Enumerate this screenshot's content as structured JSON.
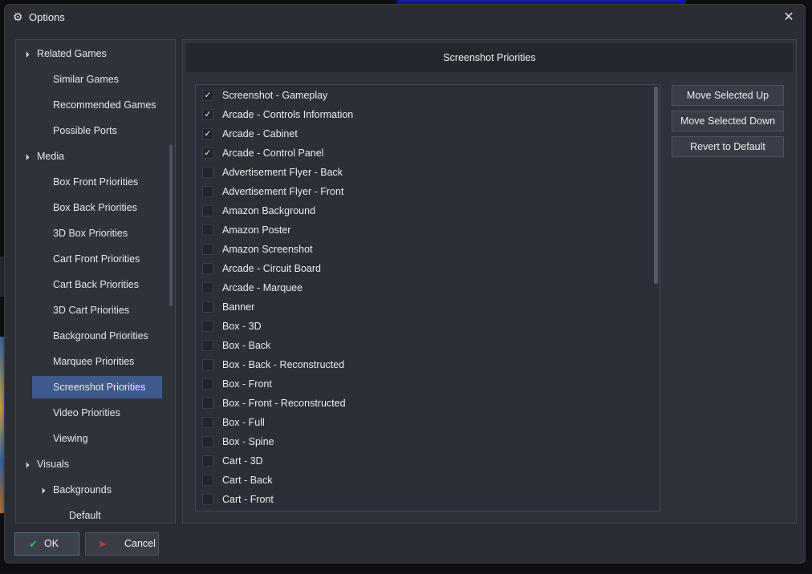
{
  "window": {
    "title": "Options",
    "icon": "gear-icon",
    "close_icon": "close-icon"
  },
  "tree": {
    "items": [
      {
        "label": "Related Games",
        "level": 0,
        "expanded": true
      },
      {
        "label": "Similar Games",
        "level": 1
      },
      {
        "label": "Recommended Games",
        "level": 1
      },
      {
        "label": "Possible Ports",
        "level": 1
      },
      {
        "label": "Media",
        "level": 0,
        "expanded": true
      },
      {
        "label": "Box Front Priorities",
        "level": 1
      },
      {
        "label": "Box Back Priorities",
        "level": 1
      },
      {
        "label": "3D Box Priorities",
        "level": 1
      },
      {
        "label": "Cart Front Priorities",
        "level": 1
      },
      {
        "label": "Cart Back Priorities",
        "level": 1
      },
      {
        "label": "3D Cart Priorities",
        "level": 1
      },
      {
        "label": "Background Priorities",
        "level": 1
      },
      {
        "label": "Marquee Priorities",
        "level": 1
      },
      {
        "label": "Screenshot Priorities",
        "level": 1,
        "selected": true
      },
      {
        "label": "Video Priorities",
        "level": 1
      },
      {
        "label": "Viewing",
        "level": 1
      },
      {
        "label": "Visuals",
        "level": 0,
        "expanded": true
      },
      {
        "label": "Backgrounds",
        "level": 1,
        "expanded": true
      },
      {
        "label": "Default",
        "level": 2
      }
    ]
  },
  "content": {
    "header": "Screenshot Priorities",
    "list": [
      {
        "label": "Screenshot - Gameplay",
        "checked": true
      },
      {
        "label": "Arcade - Controls Information",
        "checked": true
      },
      {
        "label": "Arcade - Cabinet",
        "checked": true
      },
      {
        "label": "Arcade - Control Panel",
        "checked": true
      },
      {
        "label": "Advertisement Flyer - Back",
        "checked": false
      },
      {
        "label": "Advertisement Flyer - Front",
        "checked": false
      },
      {
        "label": "Amazon Background",
        "checked": false
      },
      {
        "label": "Amazon Poster",
        "checked": false
      },
      {
        "label": "Amazon Screenshot",
        "checked": false
      },
      {
        "label": "Arcade - Circuit Board",
        "checked": false
      },
      {
        "label": "Arcade - Marquee",
        "checked": false
      },
      {
        "label": "Banner",
        "checked": false
      },
      {
        "label": "Box - 3D",
        "checked": false
      },
      {
        "label": "Box - Back",
        "checked": false
      },
      {
        "label": "Box - Back - Reconstructed",
        "checked": false
      },
      {
        "label": "Box - Front",
        "checked": false
      },
      {
        "label": "Box - Front - Reconstructed",
        "checked": false
      },
      {
        "label": "Box - Full",
        "checked": false
      },
      {
        "label": "Box - Spine",
        "checked": false
      },
      {
        "label": "Cart - 3D",
        "checked": false
      },
      {
        "label": "Cart - Back",
        "checked": false
      },
      {
        "label": "Cart - Front",
        "checked": false
      }
    ],
    "buttons": {
      "move_up": "Move Selected Up",
      "move_down": "Move Selected Down",
      "revert": "Revert to Default"
    }
  },
  "footer": {
    "ok": "OK",
    "cancel": "Cancel"
  },
  "colors": {
    "dialog_bg": "#2b2d35",
    "panel_bg": "#2f323b",
    "selection": "#3e5a8a",
    "ok_check": "#3fbf3f",
    "cancel_x": "#d23a3a"
  }
}
